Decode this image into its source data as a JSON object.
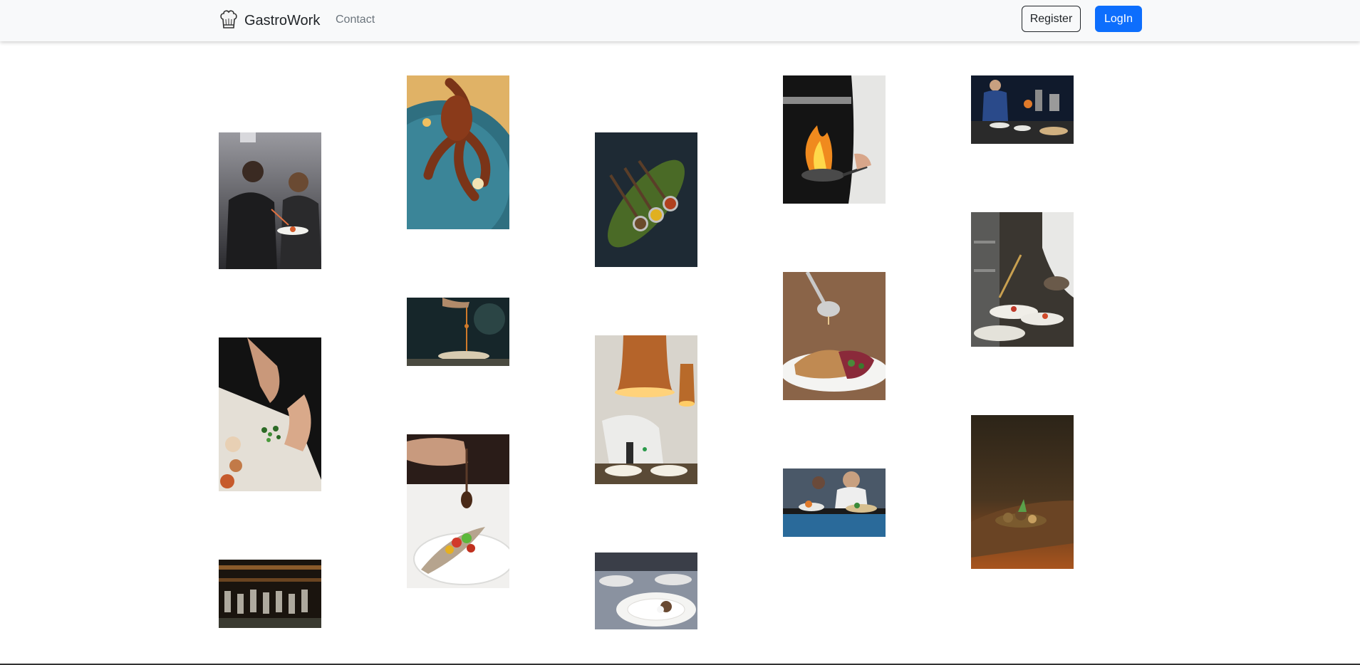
{
  "nav": {
    "brand": "GastroWork",
    "brand_icon": "chef-hat-icon",
    "contact": "Contact",
    "register": "Register",
    "login": "LogIn",
    "accent": "#0d6efd"
  },
  "gallery": {
    "photos": [
      "chefs-plating-photo",
      "octopus-dish-photo",
      "spice-spoons-photo",
      "flambe-pan-photo",
      "busy-kitchen-photo",
      "kitchen-pass-photo",
      "sauce-drizzle-photo",
      "ladle-fish-dish-photo",
      "chopping-herbs-photo",
      "heat-lamp-plating-photo",
      "plating-spoon-photo",
      "chef-service-photo",
      "wooden-board-dish-photo",
      "hanging-glasses-photo",
      "plated-dishes-photo"
    ]
  }
}
